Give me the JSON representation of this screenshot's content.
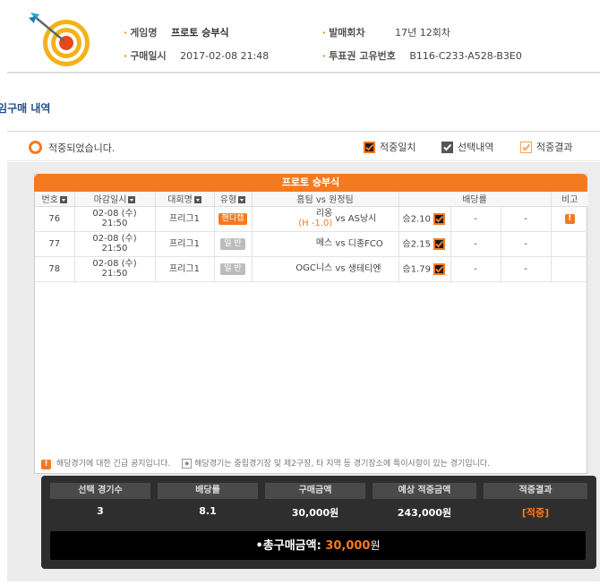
{
  "header": {
    "game_name_label": "게임명",
    "game_name": "프로토 승부식",
    "purchase_date_label": "구매일시",
    "purchase_date": "2017-02-08 21:48",
    "round_label": "발매회차",
    "round": "17년 12회차",
    "ticket_id_label": "투표권 고유번호",
    "ticket_id": "B116-C233-A528-B3E0"
  },
  "section_title": "게임구매 내역",
  "status": {
    "text": "적중되었습니다.",
    "legend": [
      {
        "label": "적중일치",
        "color": "#f47a20"
      },
      {
        "label": "선택내역",
        "color": "#555555"
      },
      {
        "label": "적중결과",
        "color": "#f5a45a"
      }
    ]
  },
  "table": {
    "title": "프로토 승부식",
    "columns": [
      "번호",
      "마감일시",
      "대회명",
      "유형",
      "홈팀 vs 원정팀",
      "배당률",
      "비고"
    ],
    "rows": [
      {
        "no": "76",
        "date": "02-08 (수)",
        "time": "21:50",
        "league": "프리그1",
        "type": "핸디캡",
        "type_kind": "hc",
        "home": "리옹",
        "handicap": "(H -1.0)",
        "vs": "vs",
        "away": "AS낭시",
        "odds": "승2.10",
        "odds2": "-",
        "odds3": "-",
        "note": "!"
      },
      {
        "no": "77",
        "date": "02-08 (수)",
        "time": "21:50",
        "league": "프리그1",
        "type": "일 반",
        "type_kind": "gen",
        "home": "메스",
        "handicap": "",
        "vs": "vs",
        "away": "디종FCO",
        "odds": "승2.15",
        "odds2": "-",
        "odds3": "-",
        "note": ""
      },
      {
        "no": "78",
        "date": "02-08 (수)",
        "time": "21:50",
        "league": "프리그1",
        "type": "일 반",
        "type_kind": "gen",
        "home": "OGC니스",
        "handicap": "",
        "vs": "vs",
        "away": "생테티엔",
        "odds": "승1.79",
        "odds2": "-",
        "odds3": "-",
        "note": ""
      }
    ]
  },
  "footer_note": {
    "icon": "!",
    "text1": "해당경기에 대한 긴급 공지입니다.",
    "star": "★",
    "text2": "해당경기는 중립경기장 및 제2구장, 타 지역 등 경기장소에 특이사항이 있는 경기입니다."
  },
  "summary": {
    "heads": [
      "선택 경기수",
      "배당률",
      "구매금액",
      "예상 적중금액",
      "적중결과"
    ],
    "values": [
      "3",
      "8.1",
      "30,000원",
      "243,000원",
      "[적중]"
    ],
    "total_label": "•총구매금액:",
    "total_amount": "30,000",
    "total_unit": "원"
  }
}
